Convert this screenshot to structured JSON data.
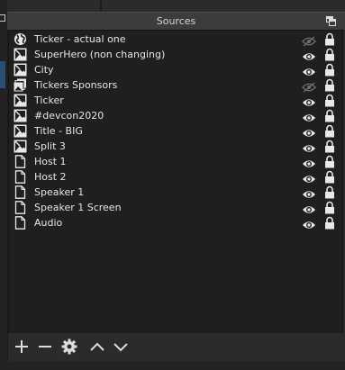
{
  "dock": {
    "title": "Sources"
  },
  "sources": [
    {
      "name": "Ticker - actual one",
      "icon": "globe-icon",
      "visible": false,
      "locked": true
    },
    {
      "name": "SuperHero (non changing)",
      "icon": "image-icon",
      "visible": true,
      "locked": true
    },
    {
      "name": "City",
      "icon": "image-icon",
      "visible": true,
      "locked": true
    },
    {
      "name": "Tickers Sponsors",
      "icon": "slideshow-icon",
      "visible": false,
      "locked": true
    },
    {
      "name": "Ticker",
      "icon": "image-icon",
      "visible": true,
      "locked": true
    },
    {
      "name": "#devcon2020",
      "icon": "image-icon",
      "visible": true,
      "locked": true
    },
    {
      "name": "Title - BIG",
      "icon": "image-icon",
      "visible": true,
      "locked": true
    },
    {
      "name": "Split 3",
      "icon": "image-icon",
      "visible": true,
      "locked": true
    },
    {
      "name": "Host 1",
      "icon": "file-icon",
      "visible": true,
      "locked": true
    },
    {
      "name": "Host 2",
      "icon": "file-icon",
      "visible": true,
      "locked": true
    },
    {
      "name": "Speaker 1",
      "icon": "file-icon",
      "visible": true,
      "locked": true
    },
    {
      "name": "Speaker 1 Screen",
      "icon": "file-icon",
      "visible": true,
      "locked": true
    },
    {
      "name": "Audio",
      "icon": "file-icon",
      "visible": true,
      "locked": true
    }
  ],
  "toolbar": {
    "buttons": [
      "add-icon",
      "remove-icon",
      "gear-icon",
      "chevron-up-icon",
      "chevron-down-icon"
    ]
  },
  "colors": {
    "list_bg": "#1f1f1f",
    "text": "#e6e6e6",
    "title_bar": "#3c3c3c"
  }
}
